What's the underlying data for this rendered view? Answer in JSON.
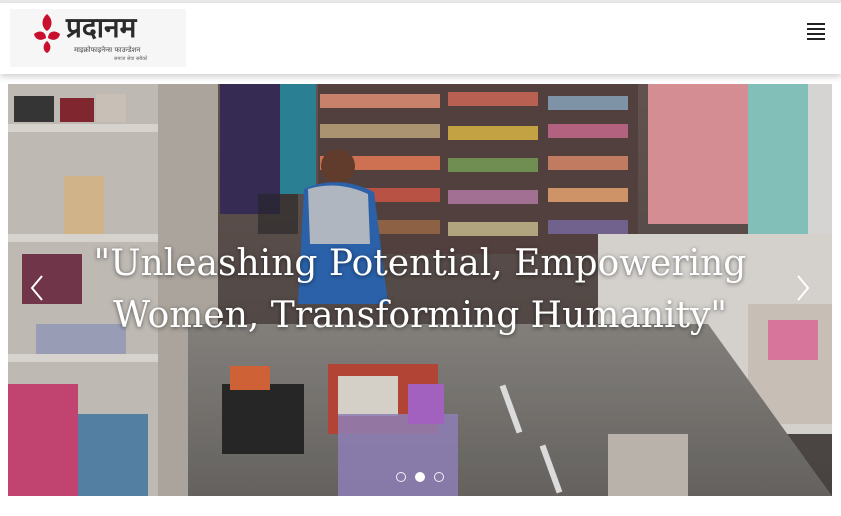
{
  "header": {
    "logo": {
      "name": "प्रदानम",
      "subtitle": "माइक्रोफाइनेन्स फाउन्डेशन",
      "tagline": "समाज सेवा सबैको",
      "accent_color": "#c8102e"
    },
    "menu_icon": "hamburger-menu-icon"
  },
  "carousel": {
    "caption": "\"Unleashing Potential, Empowering Women, Transforming Humanity\"",
    "prev_icon": "chevron-left-icon",
    "next_icon": "chevron-right-icon",
    "slide_count": 3,
    "active_slide": 2
  },
  "colors": {
    "header_bg": "#ffffff",
    "caption_text": "#ffffff"
  }
}
